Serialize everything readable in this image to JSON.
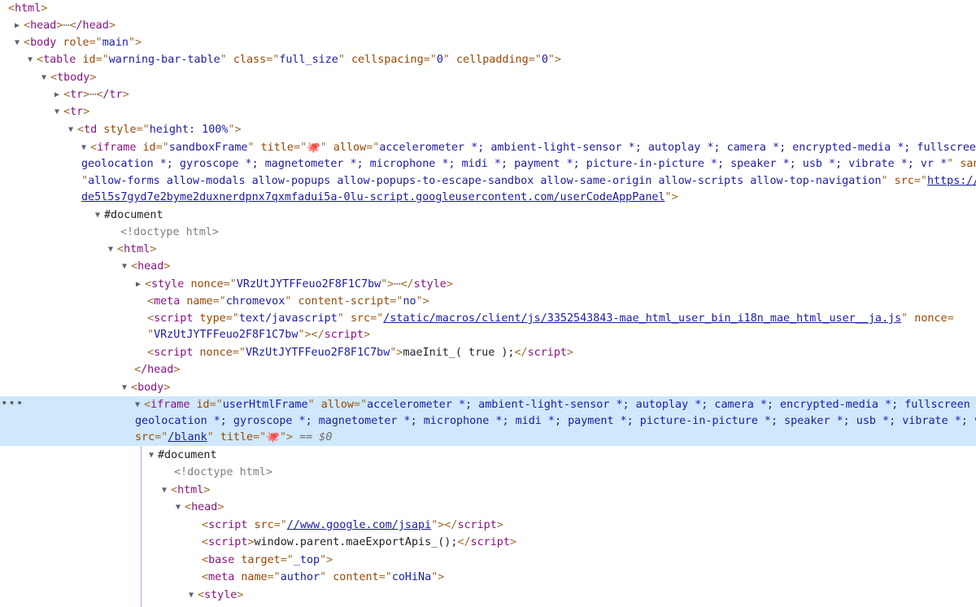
{
  "emoji": "🐙",
  "lines": {
    "l1": "html",
    "l2_tag": "head",
    "l2_close": "/head",
    "l3_tag": "body",
    "l3_attr": "role",
    "l3_val": "main",
    "l4_tag": "table",
    "l4_a1": "id",
    "l4_v1": "warning-bar-table",
    "l4_a2": "class",
    "l4_v2": "full_size",
    "l4_a3": "cellspacing",
    "l4_v3": "0",
    "l4_a4": "cellpadding",
    "l4_v4": "0",
    "l5_tag": "tbody",
    "l6_tag": "tr",
    "l6_close": "/tr",
    "l7_tag": "tr",
    "l8_tag": "td",
    "l8_attr": "style",
    "l8_val": "height: 100%",
    "iframe1_tag": "iframe",
    "iframe1_id": "sandboxFrame",
    "iframe1_allow": "accelerometer *; ambient-light-sensor *; autoplay *; camera *; encrypted-media *; fullscreen *;",
    "iframe1_allow2": "geolocation *; gyroscope *; magnetometer *; microphone *; midi *; payment *; picture-in-picture *; speaker *; usb *; vibrate *; vr *",
    "iframe1_sandbox": "allow-forms allow-modals allow-popups allow-popups-to-escape-sandbox allow-same-origin allow-scripts allow-top-navigation",
    "iframe1_src1": "https://n-",
    "iframe1_src2": "de5l5s7gyd7e2byme2duxnerdpnx7qxmfadui5a-0lu-script.googleusercontent.com/userCodeAppPanel",
    "doc1": "#document",
    "doctype1": "<!doctype html>",
    "html2": "html",
    "head2": "head",
    "style_nonce": "VRzUtJYTFFeuo2F8F1C7bw",
    "meta1_name": "chromevox",
    "meta1_content": "no",
    "script1_type": "text/javascript",
    "script1_src": "/static/macros/client/js/3352543843-mae_html_user_bin_i18n_mae_html_user__ja.js",
    "script1_nonce": "VRzUtJYTFFeuo2F8F1C7bw",
    "script2_nonce": "VRzUtJYTFFeuo2F8F1C7bw",
    "script2_body": "maeInit_( true );",
    "head2_close": "/head",
    "body2": "body",
    "iframe2_id": "userHtmlFrame",
    "iframe2_allow1": "accelerometer *; ambient-light-sensor *; autoplay *; camera *; encrypted-media *; fullscreen *;",
    "iframe2_allow2": "geolocation *; gyroscope *; magnetometer *; microphone *; midi *; payment *; picture-in-picture *; speaker *; usb *; vibrate *; vr *",
    "iframe2_src": "/blank",
    "iframe2_eq": "== $0",
    "doc2": "#document",
    "doctype2": "<!doctype html>",
    "html3": "html",
    "head3": "head",
    "script3_src": "//www.google.com/jsapi",
    "script4_body": "window.parent.maeExportApis_();",
    "base_target": "_top",
    "meta2_name": "author",
    "meta2_content": "coHiNa",
    "style2": "style"
  }
}
